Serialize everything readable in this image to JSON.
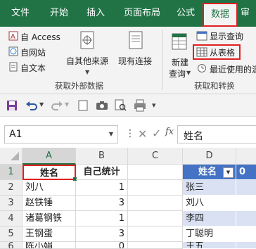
{
  "ribbon_tabs": [
    "文件",
    "开始",
    "插入",
    "页面布局",
    "公式",
    "数据",
    "审"
  ],
  "get_external": {
    "access": "自 Access",
    "web": "自网站",
    "text": "自文本",
    "other_sources": "自其他来源",
    "existing_connections": "现有连接",
    "group_label": "获取外部数据"
  },
  "get_transform": {
    "new_query_line1": "新建",
    "new_query_line2": "查询",
    "show_queries": "显示查询",
    "from_table": "从表格",
    "recent_sources": "最近使用的源",
    "group_label": "获取和转换"
  },
  "formula_bar": {
    "name_box": "A1",
    "fx": "fx",
    "value": "姓名"
  },
  "columns": [
    "A",
    "B",
    "C",
    "D",
    "0"
  ],
  "rows": [
    "1",
    "2",
    "3",
    "4",
    "5",
    "6"
  ],
  "sheet": {
    "a": [
      "姓名",
      "刘八",
      "赵铁锤",
      "诸葛钢铁",
      "王钢蛋",
      "陈小娟"
    ],
    "b": [
      "自己统计",
      "1",
      "3",
      "1",
      "3",
      "0"
    ],
    "d": [
      "姓名",
      "张三",
      "刘八",
      "李四",
      "丁聪明",
      "王五"
    ],
    "e_header": "0"
  },
  "colors": {
    "excel_green": "#217346",
    "highlight_red": "#e02020",
    "table_header_blue": "#4472c4",
    "table_band_blue": "#d9e1f2"
  }
}
